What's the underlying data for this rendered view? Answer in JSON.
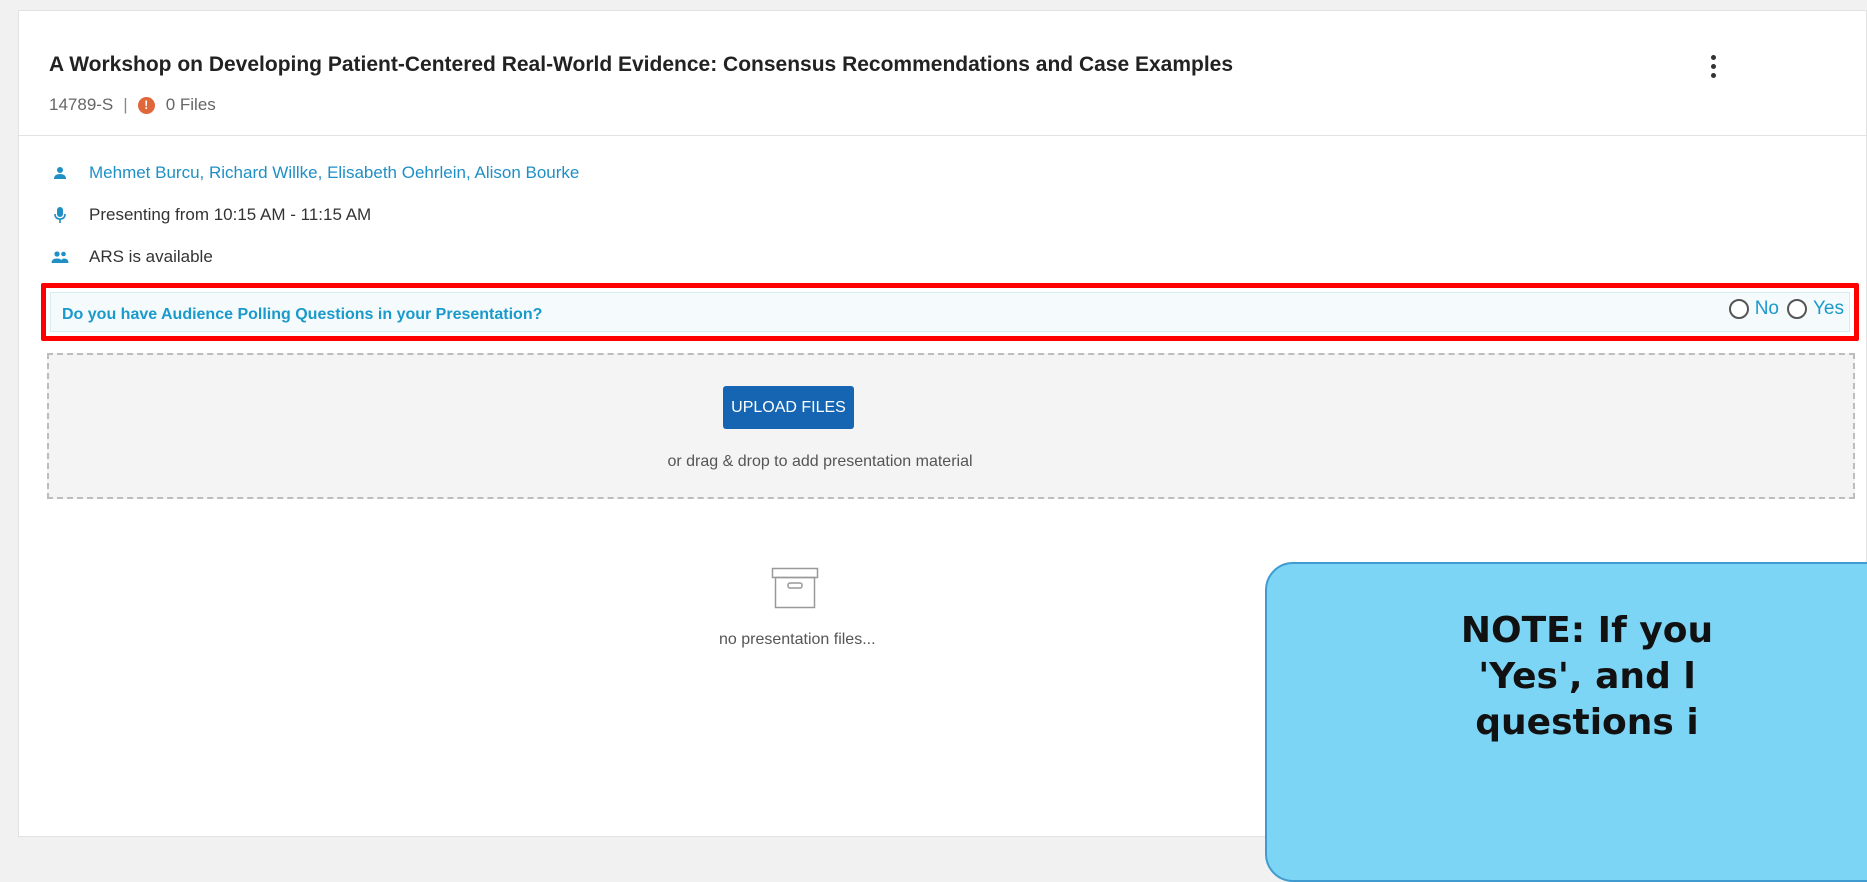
{
  "session": {
    "title": "A Workshop on Developing Patient-Centered Real-World Evidence: Consensus Recommendations and Case Examples",
    "code": "14789-S",
    "separator": "|",
    "files_alert": "!",
    "files_count": "0 Files",
    "menu_icon": "kebab-menu-icon"
  },
  "details": {
    "authors": "Mehmet Burcu, Richard Willke, Elisabeth Oehrlein, Alison Bourke",
    "presenting": "Presenting from 10:15 AM - 11:15 AM",
    "ars": "ARS is available",
    "icons": [
      "person-icon",
      "microphone-icon",
      "group-icon"
    ]
  },
  "polling": {
    "question": "Do you have Audience Polling Questions in your Presentation?",
    "option_no": "No",
    "option_yes": "Yes",
    "selected": null
  },
  "upload": {
    "button_label": "UPLOAD FILES",
    "hint": "or drag & drop to add presentation material"
  },
  "files": {
    "empty_text": "no presentation files...",
    "empty_icon": "archive-box-icon"
  },
  "note": {
    "text": "NOTE: If you\n'Yes', and l\nquestions i"
  },
  "colors": {
    "link_blue": "#1f8fc5",
    "poll_text": "#1a9acb",
    "button_blue": "#1565b3",
    "highlight_red": "#ff0000",
    "alert_orange": "#e0673a",
    "note_bg": "#7dd5f5"
  }
}
